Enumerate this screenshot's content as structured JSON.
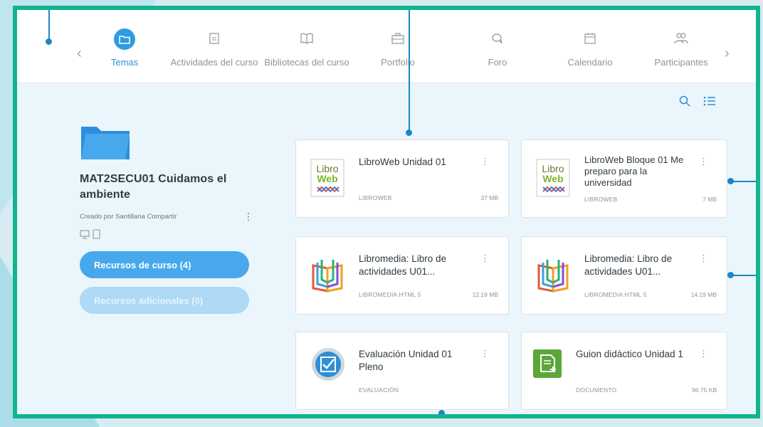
{
  "nav": {
    "tabs": [
      {
        "label": "Temas",
        "icon": "folder-icon",
        "active": true
      },
      {
        "label": "Actividades del curso",
        "icon": "clipboard-icon"
      },
      {
        "label": "Bibliotecas del curso",
        "icon": "book-icon"
      },
      {
        "label": "Portfolio",
        "icon": "briefcase-icon"
      },
      {
        "label": "Foro",
        "icon": "chat-icon"
      },
      {
        "label": "Calendario",
        "icon": "calendar-icon"
      },
      {
        "label": "Participantes",
        "icon": "people-icon"
      }
    ],
    "prev_arrow": "‹",
    "next_arrow": "›"
  },
  "course": {
    "title": "MAT2SECU01 Cuidamos el ambiente",
    "author": "Creado por Santillana Compartir",
    "kebab": "⋮",
    "buttons": {
      "primary": "Recursos de curso (4)",
      "secondary": "Recursos adicionales (0)"
    }
  },
  "cards": [
    {
      "title": "LibroWeb Unidad 01",
      "type": "LIBROWEB",
      "size": "37 MB",
      "icon": "libroweb-icon",
      "kebab": "⋮"
    },
    {
      "title": "LibroWeb Bloque 01 Me preparo para la universidad",
      "type": "LIBROWEB",
      "size": "7 MB",
      "icon": "libroweb-icon",
      "kebab": "⋮"
    },
    {
      "title": "Libromedia: Libro de actividades U01...",
      "type": "LIBROMEDIA HTML 5",
      "size": "12.19 MB",
      "icon": "libromedia-icon",
      "kebab": "⋮"
    },
    {
      "title": "Libromedia: Libro de actividades U01...",
      "type": "LIBROMEDIA HTML 5",
      "size": "14.19 MB",
      "icon": "libromedia-icon",
      "kebab": "⋮"
    },
    {
      "title": "Evaluación Unidad 01 Pleno",
      "type": "EVALUACIÓN",
      "size": "",
      "icon": "evaluation-check-icon",
      "kebab": "⋮"
    },
    {
      "title": "Guion didáctico Unidad 1",
      "type": "DOCUMENTO",
      "size": "96.75 KB",
      "icon": "document-icon",
      "kebab": "⋮"
    }
  ],
  "colors": {
    "accent": "#2f9be0",
    "frame": "#12b48f",
    "callout": "#1a86c6"
  }
}
